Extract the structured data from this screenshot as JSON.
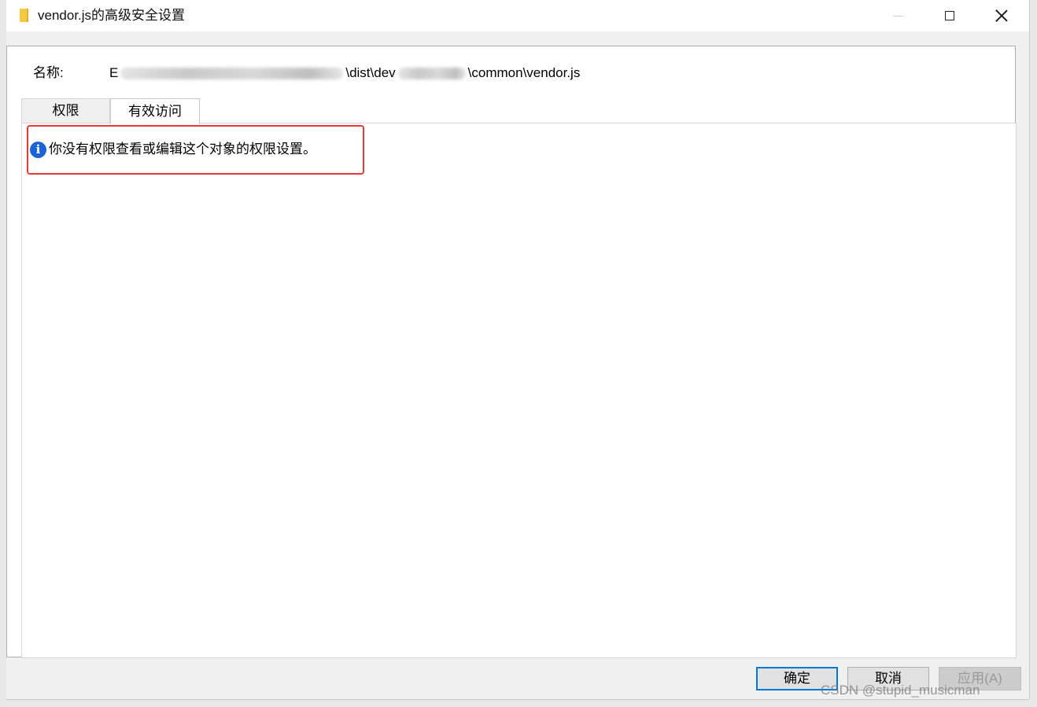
{
  "window": {
    "title": "vendor.js的高级安全设置",
    "icon": "folder-icon"
  },
  "titlebar_buttons": {
    "minimize": "minimize-icon",
    "maximize": "maximize-icon",
    "close": "close-icon"
  },
  "name_row": {
    "label": "名称:",
    "path_prefix": "E",
    "path_mid": "\\dist\\dev",
    "path_suffix": "\\common\\vendor.js"
  },
  "tabs": [
    {
      "label": "权限",
      "selected": false
    },
    {
      "label": "有效访问",
      "selected": true
    }
  ],
  "info": {
    "icon": "info-icon",
    "icon_glyph": "i",
    "message": "你没有权限查看或编辑这个对象的权限设置。"
  },
  "buttons": {
    "ok": "确定",
    "cancel": "取消",
    "apply": "应用(A)"
  },
  "watermark": "CSDN @stupid_musicman",
  "colors": {
    "highlight_border": "#e53935",
    "info_icon": "#1a64d6",
    "default_button_border": "#0078d7"
  }
}
